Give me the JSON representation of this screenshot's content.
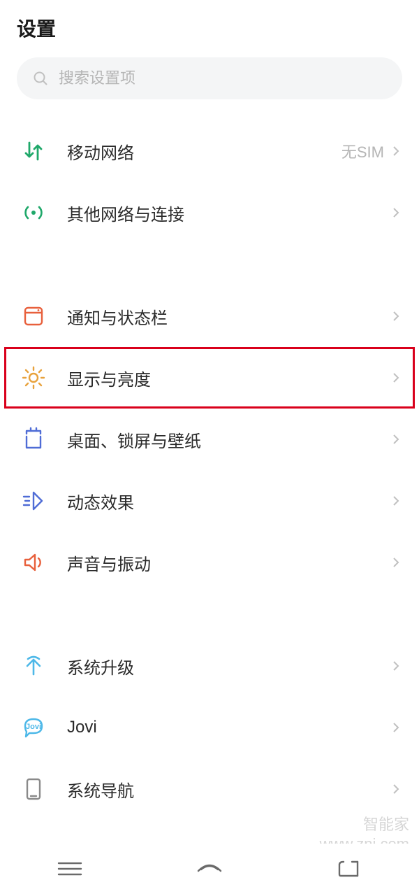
{
  "header": {
    "title": "设置"
  },
  "search": {
    "placeholder": "搜索设置项"
  },
  "groups": [
    {
      "items": [
        {
          "icon": "network-arrows-icon",
          "label": "移动网络",
          "value": "无SIM"
        },
        {
          "icon": "connections-icon",
          "label": "其他网络与连接",
          "value": ""
        }
      ]
    },
    {
      "items": [
        {
          "icon": "notification-bar-icon",
          "label": "通知与状态栏",
          "value": ""
        },
        {
          "icon": "brightness-icon",
          "label": "显示与亮度",
          "value": "",
          "highlighted": true
        },
        {
          "icon": "wallpaper-icon",
          "label": "桌面、锁屏与壁纸",
          "value": ""
        },
        {
          "icon": "motion-effect-icon",
          "label": "动态效果",
          "value": ""
        },
        {
          "icon": "sound-icon",
          "label": "声音与振动",
          "value": ""
        }
      ]
    },
    {
      "items": [
        {
          "icon": "system-update-icon",
          "label": "系统升级",
          "value": ""
        },
        {
          "icon": "jovi-icon",
          "label": "Jovi",
          "value": ""
        },
        {
          "icon": "system-nav-icon",
          "label": "系统导航",
          "value": ""
        }
      ]
    }
  ],
  "watermark": {
    "line1": "智能家",
    "line2": "www.znj.com"
  }
}
